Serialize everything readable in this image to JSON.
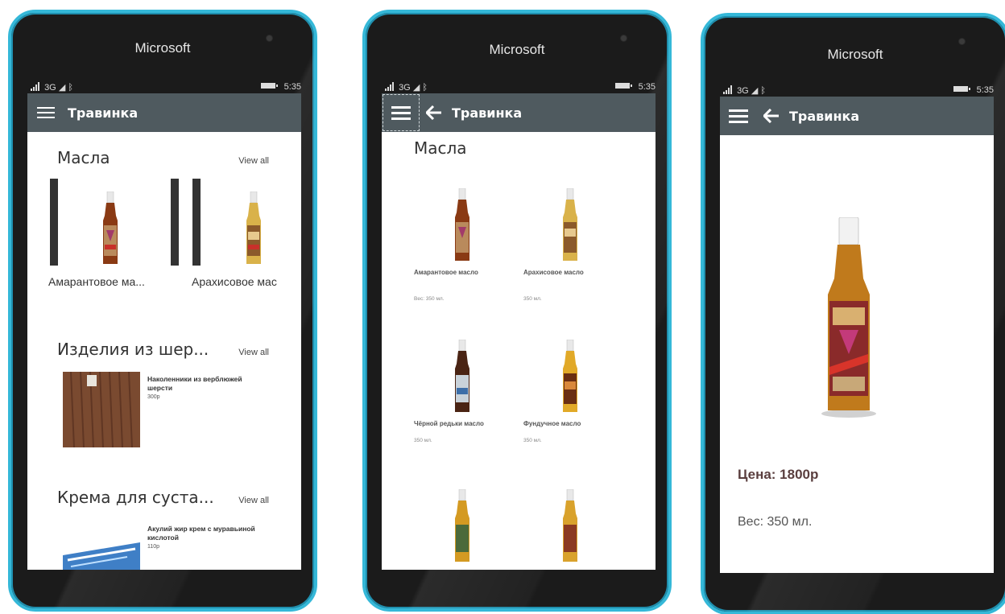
{
  "phones": [
    {
      "brand": "Microsoft",
      "status": {
        "network": "3G",
        "time": "5:35"
      },
      "appbar": {
        "title": "Травинка"
      },
      "sections": [
        {
          "title": "Масла",
          "view_all": "View all",
          "items": [
            {
              "name": "Амарантовое ма..."
            },
            {
              "name": "Арахисовое мас"
            }
          ]
        },
        {
          "title": "Изделия из шер...",
          "view_all": "View all",
          "items": [
            {
              "title": "Наколенники из верблюжей шерсти",
              "price": "300р"
            }
          ]
        },
        {
          "title": "Крема для суста...",
          "view_all": "View all",
          "items": [
            {
              "title": "Акулий жир крем с муравьиной кислотой",
              "price": "110р"
            }
          ]
        }
      ]
    },
    {
      "brand": "Microsoft",
      "status": {
        "network": "3G",
        "time": "5:35"
      },
      "appbar": {
        "title": "Травинка"
      },
      "category_title": "Масла",
      "grid": [
        {
          "name": "Амарантовое масло",
          "weight": "Вес: 350 мл."
        },
        {
          "name": "Арахисовое масло",
          "weight": "350 мл."
        },
        {
          "name": "Чёрной редьки масло",
          "weight": "350 мл."
        },
        {
          "name": "Фундучное масло",
          "weight": "350 мл."
        }
      ]
    },
    {
      "brand": "Microsoft",
      "status": {
        "network": "3G",
        "time": "5:35"
      },
      "appbar": {
        "title": "Травинка"
      },
      "detail": {
        "price": "Цена: 1800р",
        "weight": "Вес: 350 мл."
      }
    }
  ],
  "colors": {
    "appbar": "#4f5a5f",
    "phone_frame": "#35b8d8",
    "price_text": "#5a3e3e"
  }
}
